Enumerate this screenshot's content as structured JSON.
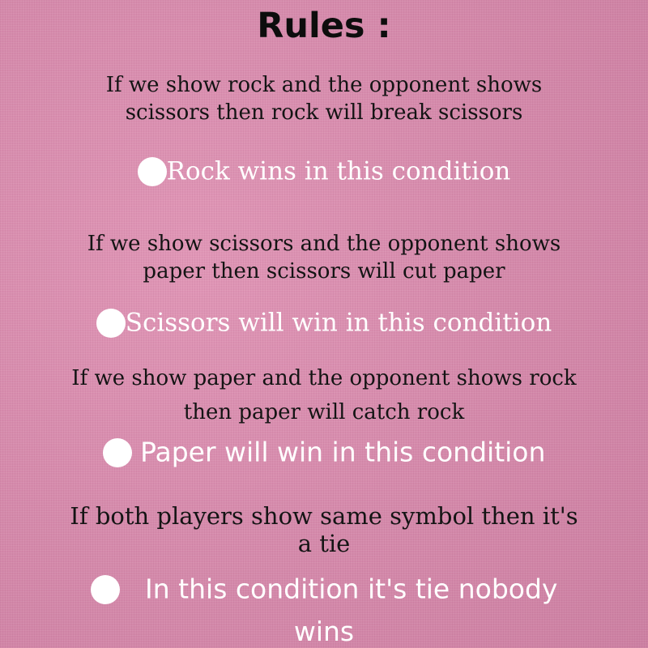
{
  "title": "Rules :",
  "rules": [
    {
      "lines": [
        "If we show rock and the opponent shows",
        "scissors then rock will break scissors"
      ],
      "bullet": "Rock wins in this condition"
    },
    {
      "lines": [
        "If we show scissors and the opponent shows",
        "paper then scissors will cut paper"
      ],
      "bullet": "Scissors will win in this condition"
    },
    {
      "lines": [
        "If we show paper and the opponent shows rock",
        "then paper will catch rock"
      ],
      "bullet": "Paper will win in this condition"
    },
    {
      "lines": [
        "If both players show same symbol then it's",
        "a tie"
      ],
      "bullet": "In this condition it's tie nobody",
      "bullet_cont": "wins"
    }
  ],
  "colors": {
    "background": "#d98aac",
    "heading_text": "#0d0d0d",
    "bullet_text": "#ffffff"
  },
  "icons": {
    "bullet": "white-circle-bullet"
  }
}
